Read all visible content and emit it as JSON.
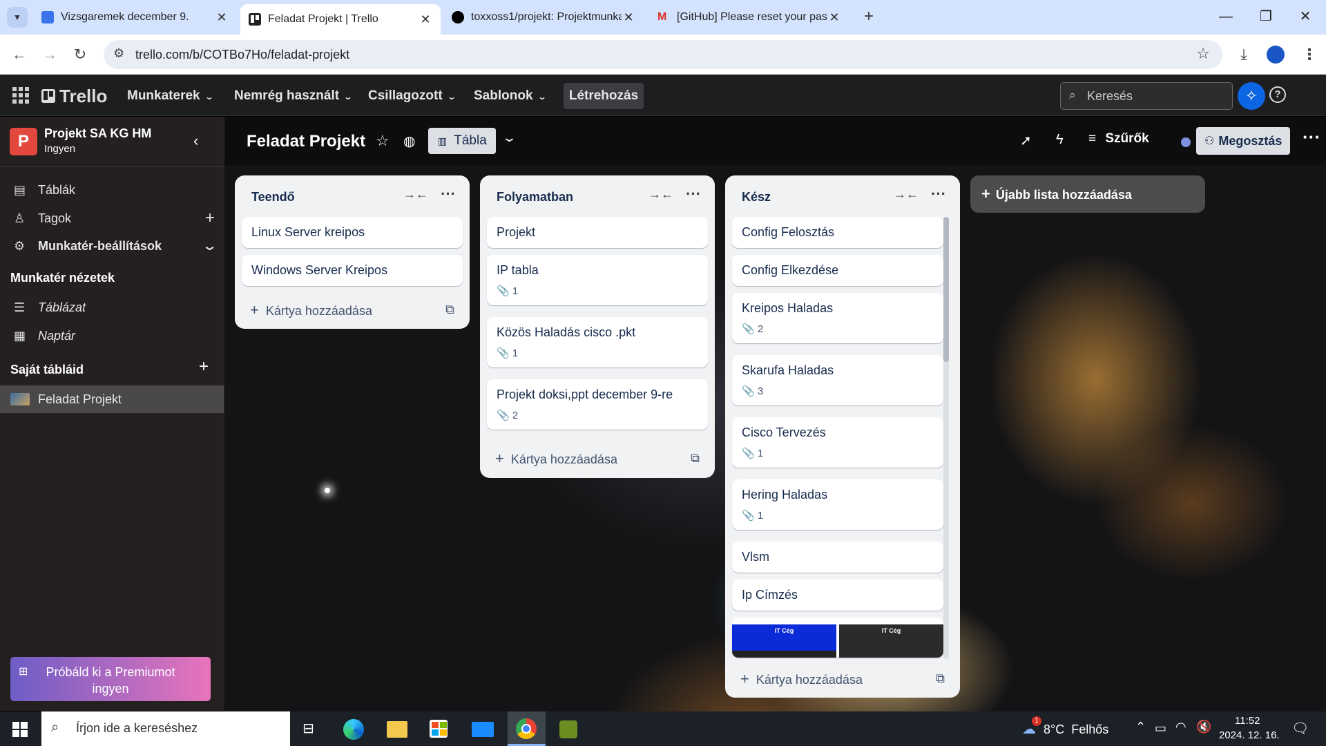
{
  "browser": {
    "tabs": [
      {
        "title": "Vizsgaremek december 9.",
        "color": "#3b74ea"
      },
      {
        "title": "Feladat Projekt | Trello",
        "color": "#222222"
      },
      {
        "title": "toxxoss1/projekt: Projektmunka",
        "color": "#000000"
      },
      {
        "title": "[GitHub] Please reset your pass",
        "color": "#d93025"
      }
    ],
    "url": "trello.com/b/COTBo7Ho/feladat-projekt"
  },
  "header": {
    "logo": "Trello",
    "menus": [
      "Munkaterek",
      "Nemrég használt",
      "Csillagozott",
      "Sablonok"
    ],
    "create_label": "Létrehozás",
    "search_placeholder": "Keresés"
  },
  "sidebar": {
    "workspace_initial": "P",
    "workspace_name": "Projekt SA KG HM",
    "workspace_plan": "Ingyen",
    "items": [
      "Táblák",
      "Tagok",
      "Munkatér-beállítások"
    ],
    "views_heading": "Munkatér nézetek",
    "views": [
      "Táblázat",
      "Naptár"
    ],
    "boards_heading": "Saját tábláid",
    "boards": [
      "Feladat Projekt"
    ],
    "premium_label": "Próbáld ki a Premiumot ingyen"
  },
  "board": {
    "title": "Feladat Projekt",
    "view_label": "Tábla",
    "filter_label": "Szűrők",
    "share_label": "Megosztás",
    "add_list_label": "Újabb lista hozzáadása",
    "add_card_label": "Kártya hozzáadása",
    "lists": [
      {
        "name": "Teendő",
        "cards": [
          {
            "title": "Linux Server kreipos",
            "attachments": ""
          },
          {
            "title": "Windows Server Kreipos",
            "attachments": ""
          }
        ]
      },
      {
        "name": "Folyamatban",
        "cards": [
          {
            "title": "Projekt",
            "attachments": ""
          },
          {
            "title": "IP tabla",
            "attachments": "1"
          },
          {
            "title": "Közös Haladás cisco .pkt",
            "attachments": "1"
          },
          {
            "title": "Projekt doksi,ppt december 9-re",
            "attachments": "2"
          }
        ]
      },
      {
        "name": "Kész",
        "cards": [
          {
            "title": "Config Felosztás",
            "attachments": ""
          },
          {
            "title": "Config Elkezdése",
            "attachments": ""
          },
          {
            "title": "Kreipos Haladas",
            "attachments": "2"
          },
          {
            "title": "Skarufa Haladas",
            "attachments": "3"
          },
          {
            "title": "Cisco Tervezés",
            "attachments": "1"
          },
          {
            "title": "Hering Haladas",
            "attachments": "1"
          },
          {
            "title": "Vlsm",
            "attachments": ""
          },
          {
            "title": "Ip Címzés",
            "attachments": ""
          }
        ],
        "thumb_labels": [
          "IT Cég",
          "IT Cég"
        ]
      }
    ]
  },
  "taskbar": {
    "search_placeholder": "Írjon ide a kereséshez",
    "weather": "8°C  Felhős",
    "weather_badge": "1",
    "time": "11:52",
    "date": "2024. 12. 16."
  },
  "colors": {
    "workspace_badge": "#e2483d",
    "premium_gradient_start": "#6e5dc6",
    "premium_gradient_end": "#e774bb",
    "atlassian_blue": "#0c66e4"
  }
}
